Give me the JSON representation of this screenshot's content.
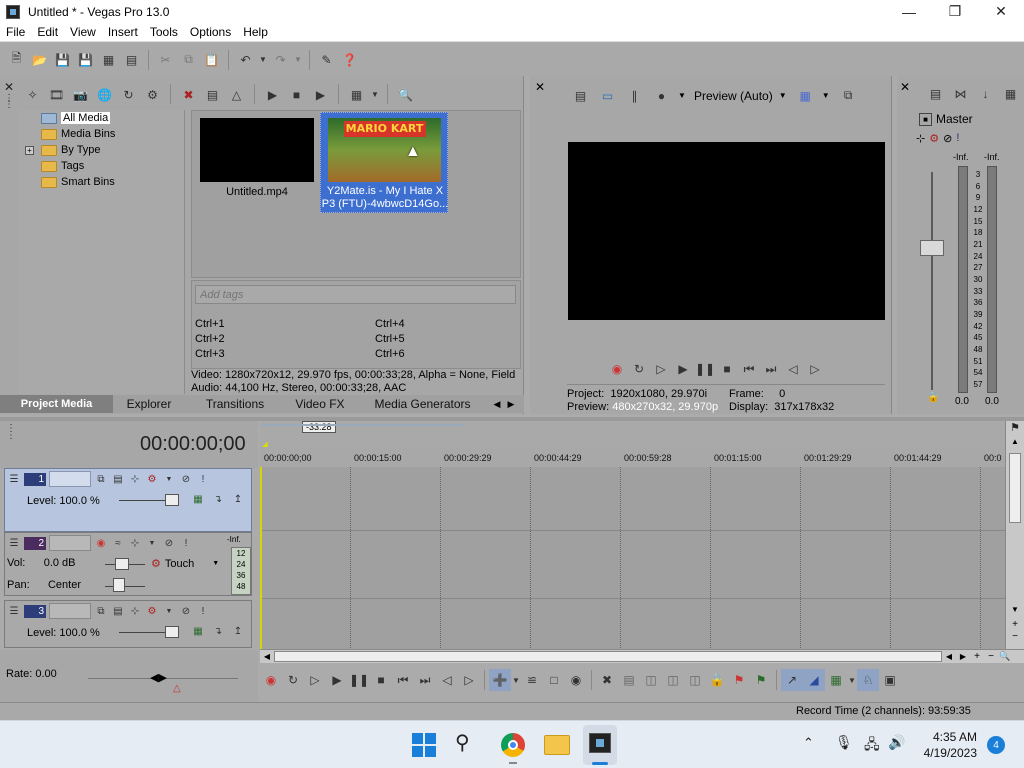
{
  "window": {
    "title": "Untitled * - Vegas Pro 13.0"
  },
  "menu": [
    "File",
    "Edit",
    "View",
    "Insert",
    "Tools",
    "Options",
    "Help"
  ],
  "media": {
    "tree": [
      {
        "label": "All Media"
      },
      {
        "label": "Media Bins"
      },
      {
        "label": "By Type"
      },
      {
        "label": "Tags"
      },
      {
        "label": "Smart Bins"
      }
    ],
    "tree_expand_glyph": "+",
    "items": [
      {
        "name": "Untitled.mp4"
      },
      {
        "name_line1": "Y2Mate.is - My I Hate X",
        "name_line2": "P3 (FTU)-4wbwcD14Go...",
        "thumb_text": "MARIO KART"
      }
    ],
    "tags_placeholder": "Add tags",
    "shortcuts": [
      "Ctrl+1",
      "Ctrl+4",
      "Ctrl+2",
      "Ctrl+5",
      "Ctrl+3",
      "Ctrl+6"
    ],
    "info_video": "Video: 1280x720x12, 29.970 fps, 00:00:33;28, Alpha = None, Field",
    "info_audio": "Audio: 44,100 Hz, Stereo, 00:00:33;28, AAC",
    "tabs": [
      "Project Media",
      "Explorer",
      "Transitions",
      "Video FX",
      "Media Generators"
    ]
  },
  "preview": {
    "mode": "Preview (Auto)",
    "project_label": "Project:",
    "project_value": "1920x1080, 29.970i",
    "preview_label": "Preview:",
    "preview_value": "480x270x32, 29.970p",
    "frame_label": "Frame:",
    "frame_value": "0",
    "display_label": "Display:",
    "display_value": "317x178x32"
  },
  "master": {
    "title": "Master",
    "inf_left": "-Inf.",
    "inf_right": "-Inf.",
    "scale": [
      "3",
      "6",
      "9",
      "12",
      "15",
      "18",
      "21",
      "24",
      "27",
      "30",
      "33",
      "36",
      "39",
      "42",
      "45",
      "48",
      "51",
      "54",
      "57"
    ],
    "bottom_left": "0.0",
    "bottom_right": "0.0"
  },
  "timeline": {
    "timecode": "00:00:00;00",
    "ruler_marker": "-33:28",
    "ruler": [
      "00:00:00;00",
      "00:00:15:00",
      "00:00:29:29",
      "00:00:44:29",
      "00:00:59:28",
      "00:01:15:00",
      "00:01:29:29",
      "00:01:44:29",
      "00:0"
    ],
    "tracks": [
      {
        "num": "1",
        "type": "video",
        "level_label": "Level:",
        "level_value": "100.0 %"
      },
      {
        "num": "2",
        "type": "audio",
        "vol_label": "Vol:",
        "vol_value": "0.0 dB",
        "pan_label": "Pan:",
        "pan_value": "Center",
        "mode": "Touch",
        "meter_top": "-Inf.",
        "meter_scale": [
          "12",
          "24",
          "36",
          "48"
        ]
      },
      {
        "num": "3",
        "type": "video",
        "level_label": "Level:",
        "level_value": "100.0 %"
      }
    ],
    "rate": "Rate: 0.00",
    "status": "Record Time (2 channels): 93:59:35"
  },
  "taskbar": {
    "time": "4:35 AM",
    "date": "4/19/2023",
    "badge": "4"
  },
  "colors": {
    "track_video_bg": "#b7c6de",
    "selection_blue": "#3d6fd1",
    "panel_gray": "#a7a7a7"
  }
}
